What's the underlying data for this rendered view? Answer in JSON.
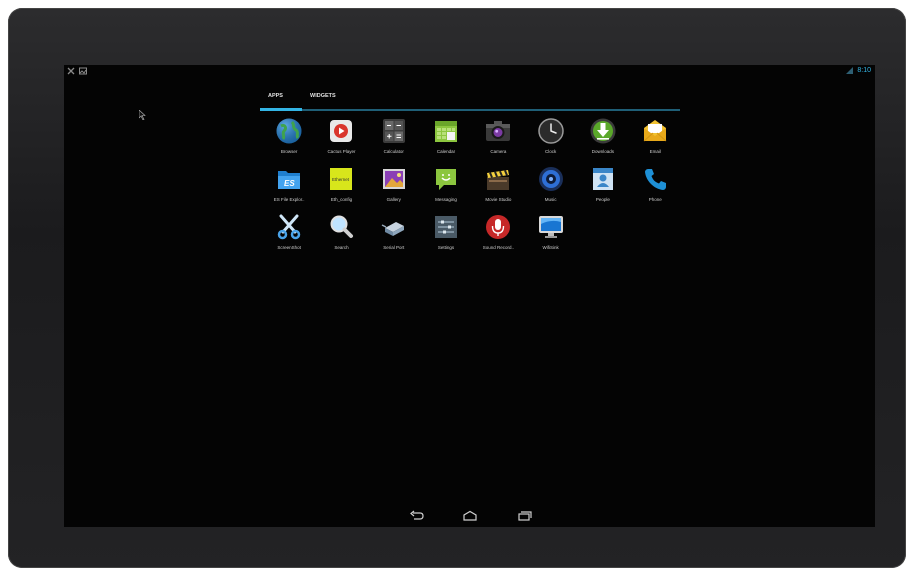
{
  "status": {
    "left_icons": [
      "tools-icon",
      "image-icon"
    ],
    "time": "8:10"
  },
  "tabs": [
    {
      "label": "APPS",
      "active": true
    },
    {
      "label": "WIDGETS",
      "active": false
    }
  ],
  "apps": [
    {
      "label": "Browser",
      "icon": "globe-icon"
    },
    {
      "label": "Cactus Player",
      "icon": "play-icon"
    },
    {
      "label": "Calculator",
      "icon": "calculator-icon"
    },
    {
      "label": "Calendar",
      "icon": "calendar-icon"
    },
    {
      "label": "Camera",
      "icon": "camera-icon"
    },
    {
      "label": "Clock",
      "icon": "clock-icon"
    },
    {
      "label": "Downloads",
      "icon": "download-icon"
    },
    {
      "label": "Email",
      "icon": "envelope-icon"
    },
    {
      "label": "ES File Explor..",
      "icon": "folder-es-icon"
    },
    {
      "label": "Eth_config",
      "icon": "ethernet-icon"
    },
    {
      "label": "Gallery",
      "icon": "gallery-icon"
    },
    {
      "label": "Messaging",
      "icon": "message-icon"
    },
    {
      "label": "Movie Studio",
      "icon": "clapperboard-icon"
    },
    {
      "label": "Music",
      "icon": "speaker-icon"
    },
    {
      "label": "People",
      "icon": "contacts-icon"
    },
    {
      "label": "Phone",
      "icon": "phone-icon"
    },
    {
      "label": "ScreenShot",
      "icon": "scissors-icon"
    },
    {
      "label": "Search",
      "icon": "magnifier-icon"
    },
    {
      "label": "Serial Port",
      "icon": "serial-port-icon"
    },
    {
      "label": "Settings",
      "icon": "settings-icon"
    },
    {
      "label": "Sound Record..",
      "icon": "microphone-icon"
    },
    {
      "label": "WifiSink",
      "icon": "monitor-icon"
    }
  ],
  "navbar": [
    "back-icon",
    "home-icon",
    "recents-icon"
  ],
  "colors": {
    "accent": "#33b5e5",
    "background": "#040404"
  }
}
